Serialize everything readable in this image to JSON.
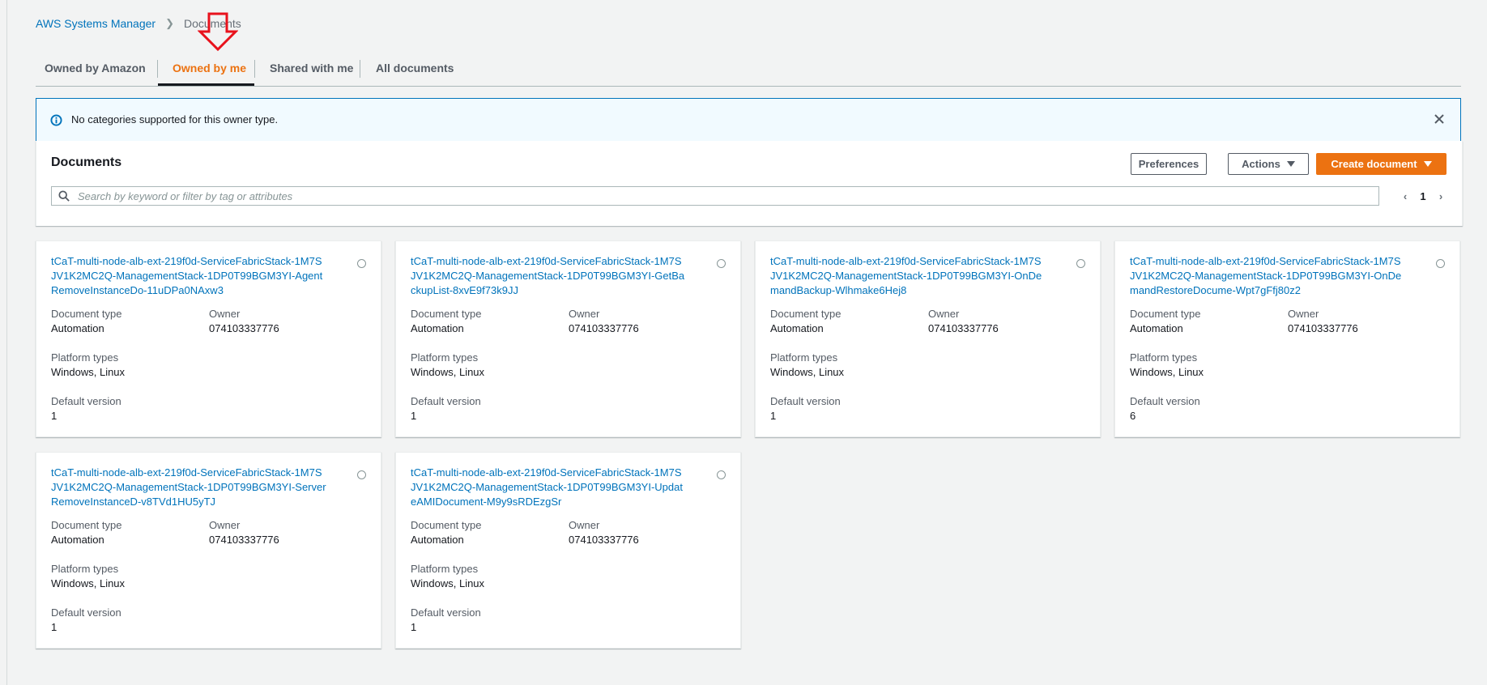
{
  "breadcrumb": {
    "parent": "AWS Systems Manager",
    "current": "Documents"
  },
  "tabs": [
    {
      "label": "Owned by Amazon",
      "active": false
    },
    {
      "label": "Owned by me",
      "active": true
    },
    {
      "label": "Shared with me",
      "active": false
    },
    {
      "label": "All documents",
      "active": false
    }
  ],
  "alert": {
    "text": "No categories supported for this owner type."
  },
  "panel": {
    "title": "Documents",
    "preferences_label": "Preferences",
    "actions_label": "Actions",
    "create_label": "Create document",
    "search_placeholder": "Search by keyword or filter by tag or attributes",
    "page": "1"
  },
  "labels": {
    "doc_type": "Document type",
    "owner": "Owner",
    "platform": "Platform types",
    "version": "Default version"
  },
  "cards": [
    {
      "title": "tCaT-multi-node-alb-ext-219f0d-ServiceFabricStack-1M7SJV1K2MC2Q-ManagementStack-1DP0T99BGM3YI-AgentRemoveInstanceDo-11uDPa0NAxw3",
      "doc_type": "Automation",
      "owner": "074103337776",
      "platform": "Windows, Linux",
      "version": "1"
    },
    {
      "title": "tCaT-multi-node-alb-ext-219f0d-ServiceFabricStack-1M7SJV1K2MC2Q-ManagementStack-1DP0T99BGM3YI-GetBackupList-8xvE9f73k9JJ",
      "doc_type": "Automation",
      "owner": "074103337776",
      "platform": "Windows, Linux",
      "version": "1"
    },
    {
      "title": "tCaT-multi-node-alb-ext-219f0d-ServiceFabricStack-1M7SJV1K2MC2Q-ManagementStack-1DP0T99BGM3YI-OnDemandBackup-Wlhmake6Hej8",
      "doc_type": "Automation",
      "owner": "074103337776",
      "platform": "Windows, Linux",
      "version": "1"
    },
    {
      "title": "tCaT-multi-node-alb-ext-219f0d-ServiceFabricStack-1M7SJV1K2MC2Q-ManagementStack-1DP0T99BGM3YI-OnDemandRestoreDocume-Wpt7gFfj80z2",
      "doc_type": "Automation",
      "owner": "074103337776",
      "platform": "Windows, Linux",
      "version": "6"
    },
    {
      "title": "tCaT-multi-node-alb-ext-219f0d-ServiceFabricStack-1M7SJV1K2MC2Q-ManagementStack-1DP0T99BGM3YI-ServerRemoveInstanceD-v8TVd1HU5yTJ",
      "doc_type": "Automation",
      "owner": "074103337776",
      "platform": "Windows, Linux",
      "version": "1"
    },
    {
      "title": "tCaT-multi-node-alb-ext-219f0d-ServiceFabricStack-1M7SJV1K2MC2Q-ManagementStack-1DP0T99BGM3YI-UpdateAMIDocument-M9y9sRDEzgSr",
      "doc_type": "Automation",
      "owner": "074103337776",
      "platform": "Windows, Linux",
      "version": "1"
    }
  ],
  "colors": {
    "accent": "#ec7211",
    "link": "#0073bb",
    "annotation_arrow": "#e8121c"
  }
}
